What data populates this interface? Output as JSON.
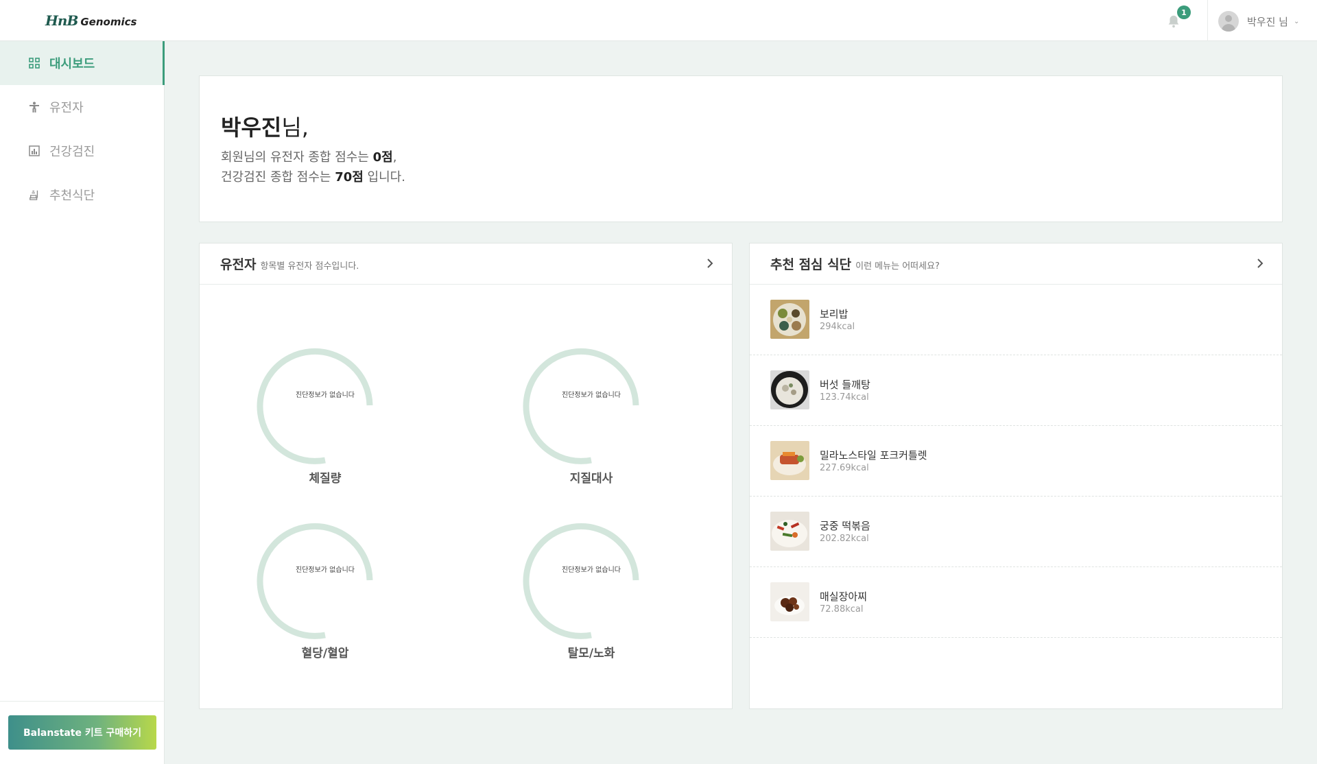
{
  "header": {
    "logo_hnb": "HnB",
    "logo_genomics": "Genomics",
    "notification_count": "1",
    "user_name": "박우진 님",
    "user_chevron": "⌄"
  },
  "sidebar": {
    "items": [
      {
        "label": "대시보드",
        "icon": "dashboard-grid-icon",
        "active": true
      },
      {
        "label": "유전자",
        "icon": "person-icon",
        "active": false
      },
      {
        "label": "건강검진",
        "icon": "chart-icon",
        "active": false
      },
      {
        "label": "추천식단",
        "icon": "meal-icon",
        "active": false
      }
    ],
    "buy_button": "Balanstate 키트 구매하기"
  },
  "welcome": {
    "name": "박우진",
    "suffix": "님,",
    "line1_prefix": "회원님의 유전자 종합 점수는 ",
    "line1_score": "0점",
    "line1_suffix": ",",
    "line2_prefix": "건강검진 종합 점수는 ",
    "line2_score": "70점",
    "line2_suffix": " 입니다."
  },
  "gene_card": {
    "title": "유전자",
    "subtitle": "항목별 유전자 점수입니다.",
    "gauges": [
      {
        "label": "체질량",
        "status": "진단정보가 없습니다"
      },
      {
        "label": "지질대사",
        "status": "진단정보가 없습니다"
      },
      {
        "label": "혈당/혈압",
        "status": "진단정보가 없습니다"
      },
      {
        "label": "탈모/노화",
        "status": "진단정보가 없습니다"
      }
    ]
  },
  "meal_card": {
    "title": "추천 점심 식단",
    "subtitle": "이런 메뉴는 어떠세요?",
    "items": [
      {
        "name": "보리밥",
        "kcal": "294kcal"
      },
      {
        "name": "버섯 들깨탕",
        "kcal": "123.74kcal"
      },
      {
        "name": "밀라노스타일 포크커틀렛",
        "kcal": "227.69kcal"
      },
      {
        "name": "궁중 떡볶음",
        "kcal": "202.82kcal"
      },
      {
        "name": "매실장아찌",
        "kcal": "72.88kcal"
      }
    ]
  },
  "colors": {
    "accent": "#3b9c7b",
    "gauge_track": "#d3e6dc",
    "background": "#eef3f1"
  }
}
